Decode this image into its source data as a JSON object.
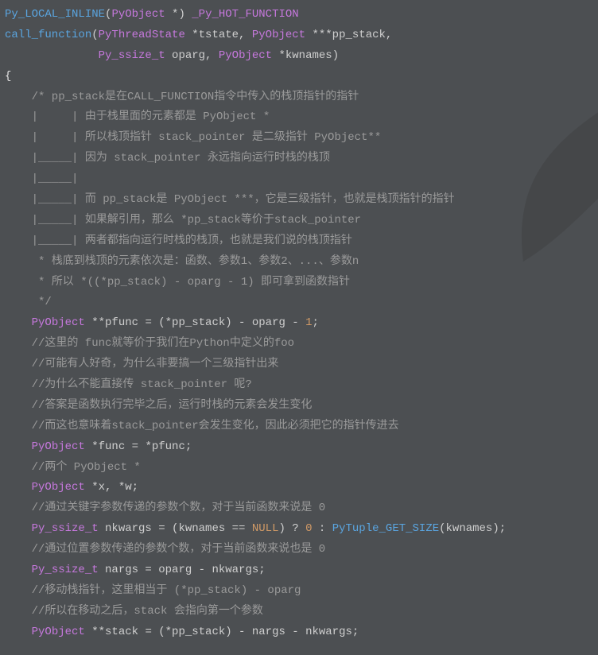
{
  "code": {
    "l1": {
      "a": "Py_LOCAL_INLINE",
      "b": "(",
      "c": "PyObject",
      "d": " *) ",
      "e": "_Py_HOT_FUNCTION"
    },
    "l2": {
      "a": "call_function",
      "b": "(",
      "c": "PyThreadState",
      "d": " *tstate, ",
      "e": "PyObject",
      "f": " ***pp_stack,"
    },
    "l3": {
      "a": "              ",
      "b": "Py_ssize_t",
      "c": " oparg, ",
      "d": "PyObject",
      "e": " *kwnames)"
    },
    "l4": "{",
    "c1": "    /* pp_stack是在CALL_FUNCTION指令中传入的栈顶指针的指针",
    "c2": "    |     | 由于栈里面的元素都是 PyObject *",
    "c3": "    |     | 所以栈顶指针 stack_pointer 是二级指针 PyObject**",
    "c4": "    |_____| 因为 stack_pointer 永远指向运行时栈的栈顶",
    "c5": "    |_____|",
    "c6": "    |_____| 而 pp_stack是 PyObject ***，它是三级指针，也就是栈顶指针的指针",
    "c7": "    |_____| 如果解引用，那么 *pp_stack等价于stack_pointer",
    "c8": "    |_____| 两者都指向运行时栈的栈顶，也就是我们说的栈顶指针",
    "c9": "     * 栈底到栈顶的元素依次是：函数、参数1、参数2、...、参数n",
    "c10": "     * 所以 *((*pp_stack) - oparg - 1) 即可拿到函数指针",
    "c11": "     */",
    "s1": {
      "t": "PyObject",
      "r": " **pfunc = (*pp_stack) - oparg - ",
      "n": "1",
      "e": ";"
    },
    "c12": "    //这里的 func就等价于我们在Python中定义的foo",
    "c13": "    //可能有人好奇，为什么非要搞一个三级指针出来",
    "c14": "    //为什么不能直接传 stack_pointer 呢?",
    "c15": "    //答案是函数执行完毕之后，运行时栈的元素会发生变化",
    "c16": "    //而这也意味着stack_pointer会发生变化，因此必须把它的指针传进去",
    "s2": {
      "t": "PyObject",
      "r": " *func = *pfunc;"
    },
    "c17": "    //两个 PyObject *",
    "s3": {
      "t": "PyObject",
      "r": " *x, *w;"
    },
    "c18": "    //通过关键字参数传递的参数个数，对于当前函数来说是 0",
    "s4": {
      "t": "Py_ssize_t",
      "r1": " nkwargs = (kwnames == ",
      "null": "NULL",
      "r2": ") ? ",
      "z": "0",
      "r3": " : ",
      "fn": "PyTuple_GET_SIZE",
      "r4": "(kwnames);"
    },
    "c19": "    //通过位置参数传递的参数个数，对于当前函数来说也是 0",
    "s5": {
      "t": "Py_ssize_t",
      "r": " nargs = oparg - nkwargs;"
    },
    "c20": "    //移动栈指针，这里相当于 (*pp_stack) - oparg",
    "c21": "    //所以在移动之后，stack 会指向第一个参数",
    "s6": {
      "t": "PyObject",
      "r": " **stack = (*pp_stack) - nargs - nkwargs;"
    }
  }
}
